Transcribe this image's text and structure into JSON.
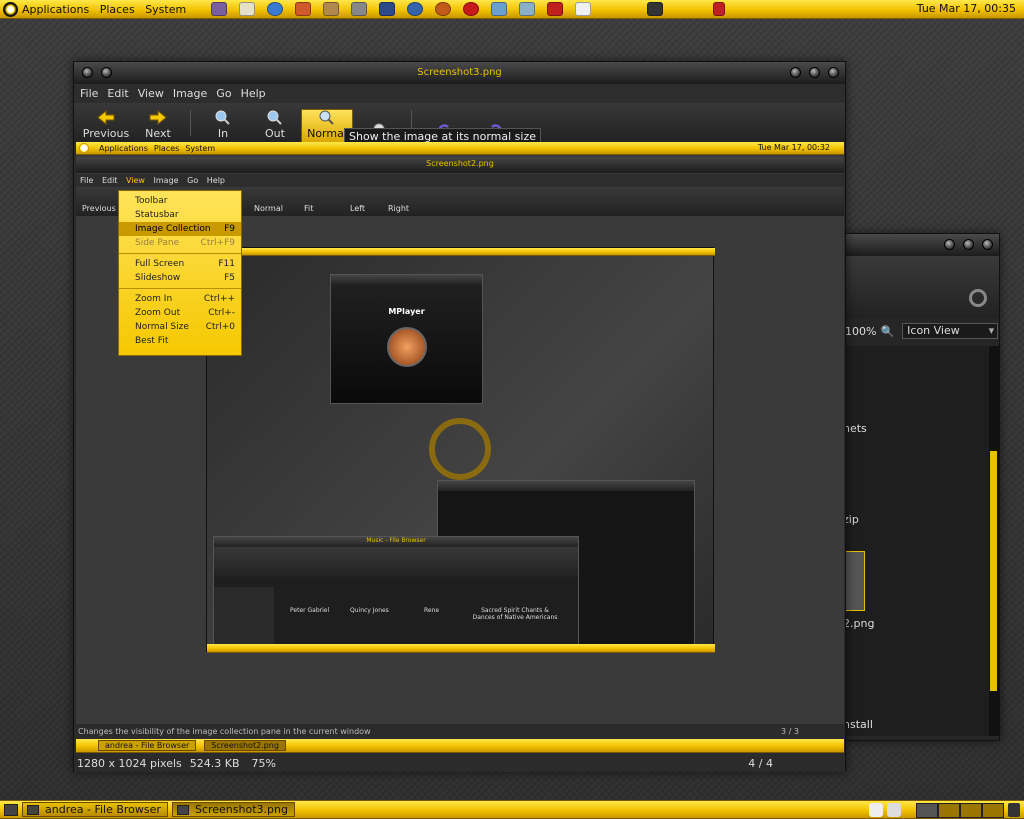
{
  "top_panel": {
    "menus": [
      "Applications",
      "Places",
      "System"
    ],
    "clock": "Tue Mar 17, 00:35"
  },
  "bottom_panel": {
    "tasks": [
      "andrea - File Browser",
      "Screenshot3.png"
    ]
  },
  "main_window": {
    "title": "Screenshot3.png",
    "menus": [
      "File",
      "Edit",
      "View",
      "Image",
      "Go",
      "Help"
    ],
    "toolbar": [
      "Previous",
      "Next",
      "In",
      "Out",
      "Normal"
    ],
    "tooltip": "Show the image at its normal size",
    "status_hint": "Changes the visibility of the image collection pane in the current window",
    "status_counter": "3 / 3",
    "taskbar_inner": [
      "andrea - File Browser",
      "Screenshot2.png"
    ],
    "statusbar": {
      "dimensions": "1280 x 1024 pixels",
      "size": "524.3 KB",
      "zoom": "75%",
      "position": "4 / 4"
    }
  },
  "inner_screenshot": {
    "panel_menus": [
      "Applications",
      "Places",
      "System"
    ],
    "clock": "Tue Mar 17, 00:32",
    "title": "Screenshot2.png",
    "menus": [
      "File",
      "Edit",
      "View",
      "Image",
      "Go",
      "Help"
    ],
    "toolbar": [
      "Previous",
      "Normal",
      "Fit",
      "Left",
      "Right"
    ],
    "view_menu": [
      {
        "label": "Toolbar",
        "accel": ""
      },
      {
        "label": "Statusbar",
        "accel": ""
      },
      {
        "label": "Image Collection",
        "accel": "F9"
      },
      {
        "label": "Side Pane",
        "accel": "Ctrl+F9"
      },
      {
        "label": "Full Screen",
        "accel": "F11"
      },
      {
        "label": "Slideshow",
        "accel": "F5"
      },
      {
        "label": "Zoom In",
        "accel": "Ctrl++"
      },
      {
        "label": "Zoom Out",
        "accel": "Ctrl+-"
      },
      {
        "label": "Normal Size",
        "accel": "Ctrl+0"
      },
      {
        "label": "Best Fit",
        "accel": ""
      }
    ],
    "mplayer_title": "MPlayer",
    "filebrowser_title": "Music - File Browser",
    "folders": [
      "Peter Gabriel",
      "Quincy Jones",
      "Rene",
      "Sacred Spirit Chants & Dances of Native Americans"
    ]
  },
  "back_window": {
    "zoom": "100%",
    "view_mode": "Icon View",
    "items": [
      "nets",
      "zip",
      "2.png",
      "nstall"
    ]
  }
}
